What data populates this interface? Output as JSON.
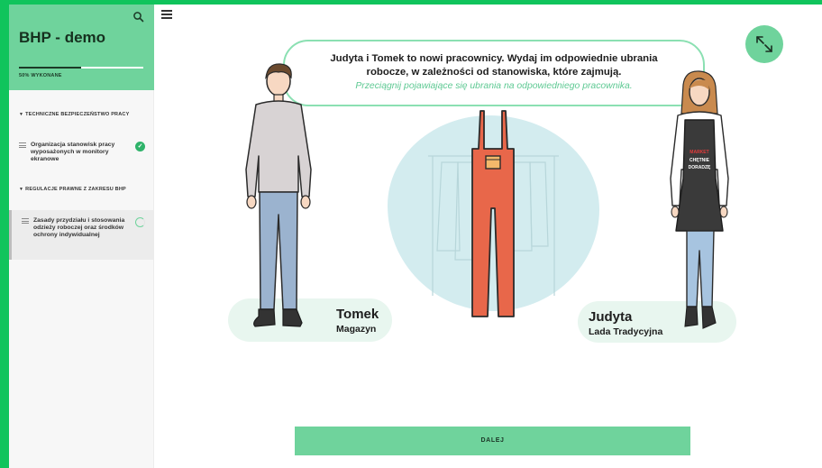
{
  "sidebar": {
    "title": "BHP - demo",
    "progress_label": "50% WYKONANE",
    "progress_fraction": 0.5,
    "sections": [
      {
        "label": "TECHNICZNE BEZPIECZEŃSTWO PRACY"
      },
      {
        "label": "REGULACJE PRAWNE Z ZAKRESU BHP"
      }
    ],
    "items": [
      {
        "label": "Organizacja stanowisk pracy wyposażonych w monitory ekranowe",
        "status": "completed"
      },
      {
        "label": "Zasady przydziału i stosowania odzieży roboczej oraz środków ochrony indywidualnej",
        "status": "in-progress"
      }
    ]
  },
  "instruction": {
    "line1": "Judyta i Tomek to nowi pracownicy. Wydaj im odpowiednie ubrania",
    "line2": "robocze, w zależności od stanowiska, które zajmują.",
    "hint": "Przeciągnij pojawiające się ubrania na odpowiedniego pracownika."
  },
  "workers": [
    {
      "name": "Tomek",
      "role": "Magazyn"
    },
    {
      "name": "Judyta",
      "role": "Lada Tradycyjna"
    }
  ],
  "apron_text": {
    "brand": "MARKET",
    "line1": "CHĘTNIE",
    "line2": "DORADZĘ"
  },
  "next_button": {
    "label": "DALEJ"
  },
  "colors": {
    "outer_frame": "#10c45c",
    "accent": "#6fd39c",
    "overalls": "#e8674a",
    "hint_text": "#5ec993"
  },
  "icons": {
    "search": "search-icon",
    "menu": "hamburger-menu-icon",
    "expand": "expand-arrows-icon",
    "completed": "check-circle-icon",
    "in_progress": "progress-ring-icon"
  }
}
